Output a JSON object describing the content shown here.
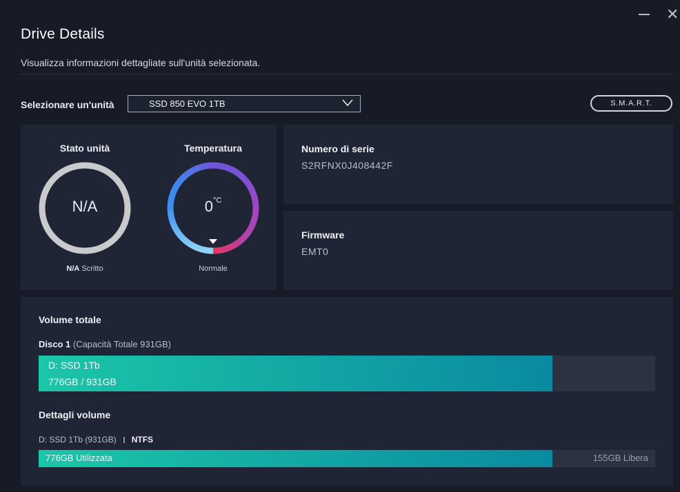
{
  "window": {
    "title": "Drive Details",
    "subtitle": "Visualizza informazioni dettagliate sull'unità selezionata.",
    "minimize_icon": "minimize-icon",
    "close_icon": "close-icon",
    "close_glyph": "✕"
  },
  "selector": {
    "label": "Selezionare un'unità",
    "value": "SSD 850 EVO 1TB",
    "smart_button": "S.M.A.R.T."
  },
  "status": {
    "title": "Stato unità",
    "value": "N/A",
    "caption_bold": "N/A",
    "caption_text": " Scritto"
  },
  "temperature": {
    "title": "Temperatura",
    "value": "0",
    "unit": "°C",
    "caption": "Normale",
    "level": 0
  },
  "serial": {
    "label": "Numero di serie",
    "value": "S2RFNX0J408442F"
  },
  "firmware": {
    "label": "Firmware",
    "value": "EMT0"
  },
  "volume": {
    "title": "Volume totale",
    "disk_name": "Disco 1",
    "disk_capacity": " (Capacità Totale 931GB)",
    "partition_name": "D: SSD 1Tb",
    "partition_usage": "776GB / 931GB",
    "used_fraction": 0.833,
    "details_title": "Dettagli volume",
    "details_partition": "D: SSD 1Tb (931GB)",
    "filesystem": "NTFS",
    "used_label": "776GB Utilizzata",
    "free_label": "155GB Libera"
  },
  "colors": {
    "background": "#161b27",
    "panel": "#1f2535",
    "accent_start": "#1cc6a8",
    "accent_end": "#0a8aa0"
  }
}
